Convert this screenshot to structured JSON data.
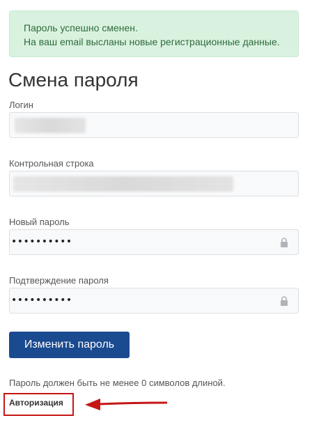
{
  "alert": {
    "line1": "Пароль успешно сменен.",
    "line2": "На ваш email высланы новые регистрационные данные."
  },
  "form": {
    "title": "Смена пароля",
    "login": {
      "label": "Логин",
      "value": ""
    },
    "checkword": {
      "label": "Контрольная строка",
      "value": ""
    },
    "new_password": {
      "label": "Новый пароль",
      "value": "••••••••••"
    },
    "confirm_password": {
      "label": "Подтверждение пароля",
      "value": "••••••••••"
    },
    "submit_label": "Изменить пароль",
    "hint": "Пароль должен быть не менее 0 символов длиной.",
    "auth_link": "Авторизация"
  },
  "icons": {
    "lock": "lock-icon",
    "arrow": "arrow-left-icon"
  },
  "colors": {
    "alert_bg": "#d9f2df",
    "alert_text": "#2f6b3d",
    "button_bg": "#1a4a8f",
    "highlight": "#c51616"
  }
}
